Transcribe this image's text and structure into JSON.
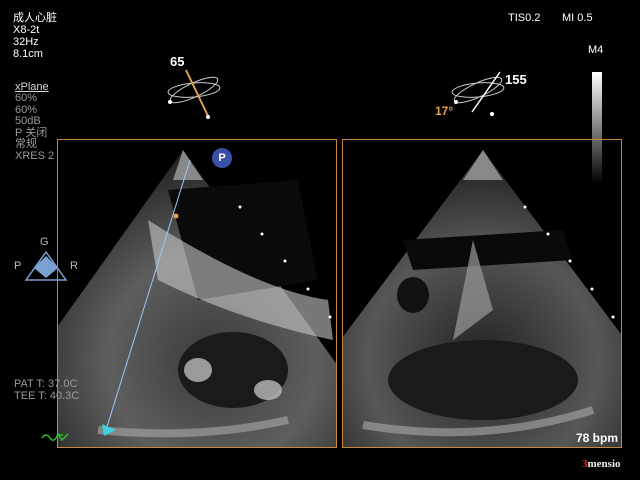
{
  "header": {
    "preset": "成人心脏",
    "probe": "X8-2t",
    "frame_rate": "32Hz",
    "depth": "8.1cm"
  },
  "xplane": {
    "title": "xPlane",
    "settings": [
      "60%",
      "60%",
      "50dB",
      "P 关闭",
      "常规",
      "XRES 2"
    ]
  },
  "indices": {
    "tis": "TIS0.2",
    "mi": "MI 0.5"
  },
  "grayscale": {
    "label": "M4"
  },
  "planes": {
    "left_angle": "65",
    "right_angle": "155",
    "right_tilt": "17°"
  },
  "orientation": {
    "top": "G",
    "left": "P",
    "right": "R"
  },
  "probe_marker": "P",
  "temperatures": {
    "patient": "PAT T: 37.0C",
    "tee": "TEE T: 40.3C"
  },
  "heart_rate": "78 bpm",
  "watermark": {
    "num": "3",
    "text": "mensio"
  },
  "colors": {
    "panel_border": "#c8873c",
    "angle_label": "#e0a050",
    "probe_marker": "#3a4fa8",
    "cursor_line": "#9ec8ff"
  }
}
